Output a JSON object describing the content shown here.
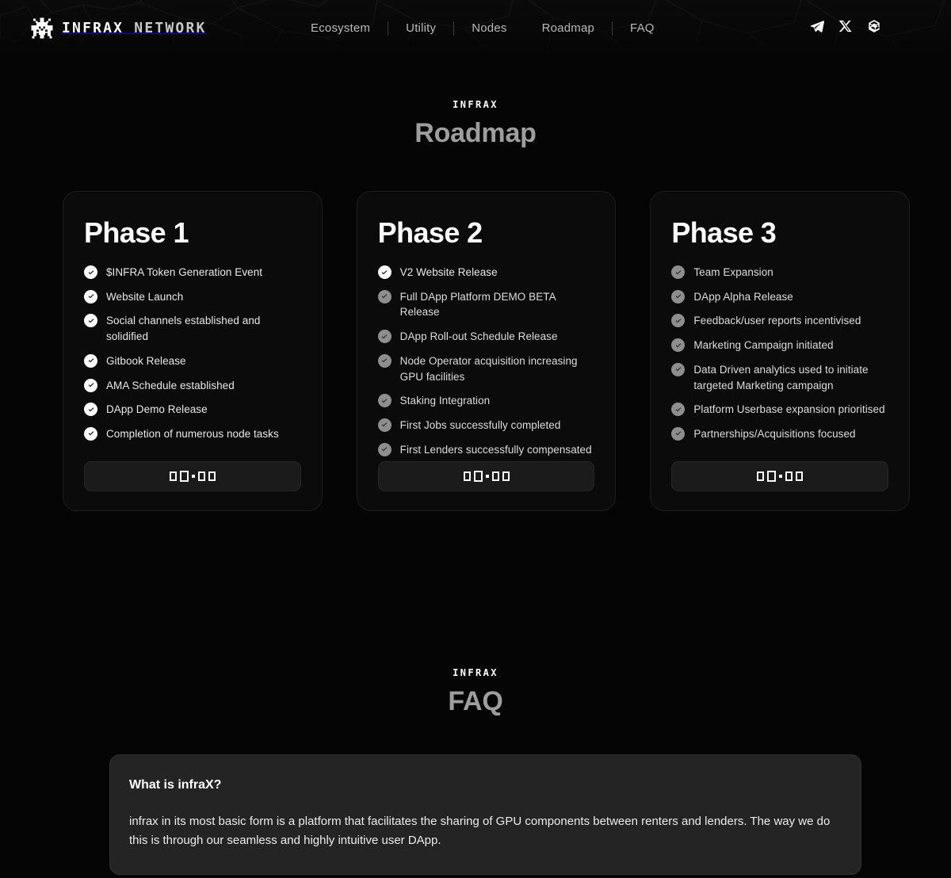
{
  "brand": {
    "logo_icon": "pixel-invader-icon",
    "name_primary": "INFRAX",
    "name_secondary": "NETWORK"
  },
  "nav": {
    "items": [
      {
        "label": "Ecosystem"
      },
      {
        "label": "Utility"
      },
      {
        "label": "Nodes"
      },
      {
        "label": "Roadmap"
      },
      {
        "label": "FAQ"
      }
    ]
  },
  "socials": [
    {
      "name": "telegram-icon",
      "label": "Telegram"
    },
    {
      "name": "x-twitter-icon",
      "label": "X"
    },
    {
      "name": "chain-icon",
      "label": "Chain"
    }
  ],
  "roadmap": {
    "eyebrow": "INFRAX",
    "title": "Roadmap",
    "phases": [
      {
        "title": "Phase 1",
        "footer_text": "▮▮·▮▮",
        "items": [
          {
            "label": "$INFRA Token Generation Event",
            "done": true
          },
          {
            "label": "Website Launch",
            "done": true
          },
          {
            "label": "Social channels established and solidified",
            "done": true
          },
          {
            "label": "Gitbook Release",
            "done": true
          },
          {
            "label": "AMA Schedule established",
            "done": true
          },
          {
            "label": "DApp Demo Release",
            "done": true
          },
          {
            "label": "Completion of numerous node tasks",
            "done": true
          }
        ]
      },
      {
        "title": "Phase 2",
        "footer_text": "▮▮·▮▮",
        "items": [
          {
            "label": "V2 Website Release",
            "done": true
          },
          {
            "label": "Full DApp Platform DEMO BETA Release",
            "done": false
          },
          {
            "label": "DApp Roll-out Schedule Release",
            "done": false
          },
          {
            "label": "Node Operator acquisition increasing GPU facilities",
            "done": false
          },
          {
            "label": "Staking Integration",
            "done": false
          },
          {
            "label": "First Jobs successfully completed",
            "done": false
          },
          {
            "label": "First Lenders successfully compensated",
            "done": false
          }
        ]
      },
      {
        "title": "Phase 3",
        "footer_text": "▮▮·▮▮",
        "items": [
          {
            "label": "Team Expansion",
            "done": false
          },
          {
            "label": "DApp Alpha Release",
            "done": false
          },
          {
            "label": "Feedback/user reports incentivised",
            "done": false
          },
          {
            "label": "Marketing Campaign initiated",
            "done": false
          },
          {
            "label": "Data Driven analytics used to initiate targeted Marketing campaign",
            "done": false
          },
          {
            "label": "Platform Userbase expansion prioritised",
            "done": false
          },
          {
            "label": "Partnerships/Acquisitions focused",
            "done": false
          }
        ]
      }
    ]
  },
  "faq": {
    "eyebrow": "INFRAX",
    "title": "FAQ",
    "entries": [
      {
        "question": "What is infraX?",
        "answer": "infrax in its most basic form is a platform that facilitates the sharing of GPU components between renters and lenders. The way we do this is through our seamless and highly intuitive user DApp."
      }
    ]
  },
  "colors": {
    "page_bg": "#050505",
    "card_bg": "#0b0b0b",
    "faq_bg": "#242424",
    "accent": "#ffffff",
    "muted": "#9e9e9e",
    "check_done": "#ffffff",
    "check_todo": "#8e8e8e"
  }
}
